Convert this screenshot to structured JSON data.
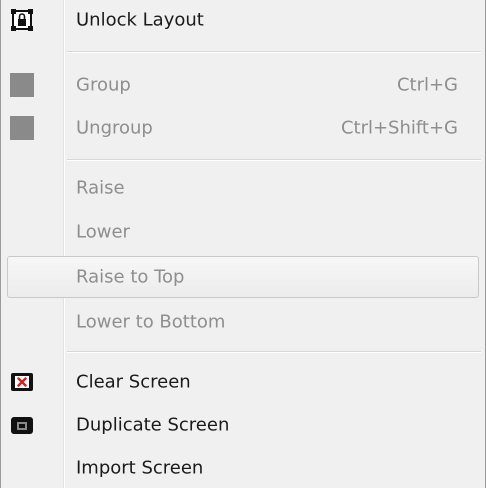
{
  "menu": {
    "items": [
      {
        "label": "Unlock Layout",
        "shortcut": "",
        "icon": "unlock-layout-icon",
        "disabled": false
      },
      {
        "label": "Group",
        "shortcut": "Ctrl+G",
        "icon": "group-icon",
        "disabled": true
      },
      {
        "label": "Ungroup",
        "shortcut": "Ctrl+Shift+G",
        "icon": "ungroup-icon",
        "disabled": true
      },
      {
        "label": "Raise",
        "shortcut": "",
        "icon": "",
        "disabled": true
      },
      {
        "label": "Lower",
        "shortcut": "",
        "icon": "",
        "disabled": true
      },
      {
        "label": "Raise to Top",
        "shortcut": "",
        "icon": "",
        "disabled": true,
        "highlighted": true
      },
      {
        "label": "Lower to Bottom",
        "shortcut": "",
        "icon": "",
        "disabled": true
      },
      {
        "label": "Clear Screen",
        "shortcut": "",
        "icon": "clear-screen-icon",
        "disabled": false
      },
      {
        "label": "Duplicate Screen",
        "shortcut": "",
        "icon": "duplicate-screen-icon",
        "disabled": false
      },
      {
        "label": "Import Screen",
        "shortcut": "",
        "icon": "",
        "disabled": false
      }
    ]
  },
  "colors": {
    "menu_bg": "#f0f0f0",
    "text": "#1a1a1a",
    "disabled_text": "#8e8e8e",
    "icon_gray": "#8a8a8a",
    "clear_icon_red": "#d42020"
  }
}
